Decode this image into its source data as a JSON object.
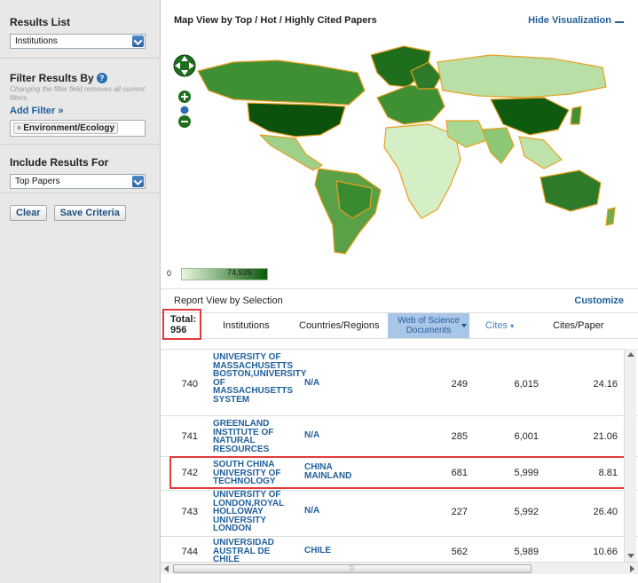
{
  "sidebar": {
    "results_list_title": "Results List",
    "results_list_value": "Institutions",
    "filter_title": "Filter Results By",
    "filter_note": "Changing the filter field removes all current filters.",
    "add_filter": "Add Filter »",
    "active_filter": "Environment/Ecology",
    "include_title": "Include Results For",
    "include_value": "Top Papers",
    "clear_button": "Clear",
    "save_button": "Save Criteria"
  },
  "visualization": {
    "title": "Map View by Top / Hot / Highly Cited Papers",
    "hide_link": "Hide Visualization",
    "legend_min": "0",
    "legend_max": "74,939",
    "colors": {
      "low": "#e8f6df",
      "mid": "#6fae4c",
      "high": "#0a5a0a",
      "border": "#f0a020"
    }
  },
  "report": {
    "title": "Report View by Selection",
    "customize": "Customize",
    "total_label": "Total:",
    "total_value": "956",
    "columns": {
      "institutions": "Institutions",
      "countries": "Countries/Regions",
      "wos": "Web of Science Documents",
      "cites": "Cites",
      "cites_per_paper": "Cites/Paper"
    },
    "rows": [
      {
        "rank": "740",
        "institution": "UNIVERSITY OF MASSACHUSETTS BOSTON,UNIVERSITY OF MASSACHUSETTS SYSTEM",
        "country": "N/A",
        "docs": "249",
        "cites": "6,015",
        "cpp": "24.16"
      },
      {
        "rank": "741",
        "institution": "GREENLAND INSTITUTE OF NATURAL RESOURCES",
        "country": "N/A",
        "docs": "285",
        "cites": "6,001",
        "cpp": "21.06"
      },
      {
        "rank": "742",
        "institution": "SOUTH CHINA UNIVERSITY OF TECHNOLOGY",
        "country": "CHINA MAINLAND",
        "docs": "681",
        "cites": "5,999",
        "cpp": "8.81"
      },
      {
        "rank": "743",
        "institution": "UNIVERSITY OF LONDON,ROYAL HOLLOWAY UNIVERSITY LONDON",
        "country": "N/A",
        "docs": "227",
        "cites": "5,992",
        "cpp": "26.40"
      },
      {
        "rank": "744",
        "institution": "UNIVERSIDAD AUSTRAL DE CHILE",
        "country": "CHILE",
        "docs": "562",
        "cites": "5,989",
        "cpp": "10.66"
      }
    ]
  }
}
